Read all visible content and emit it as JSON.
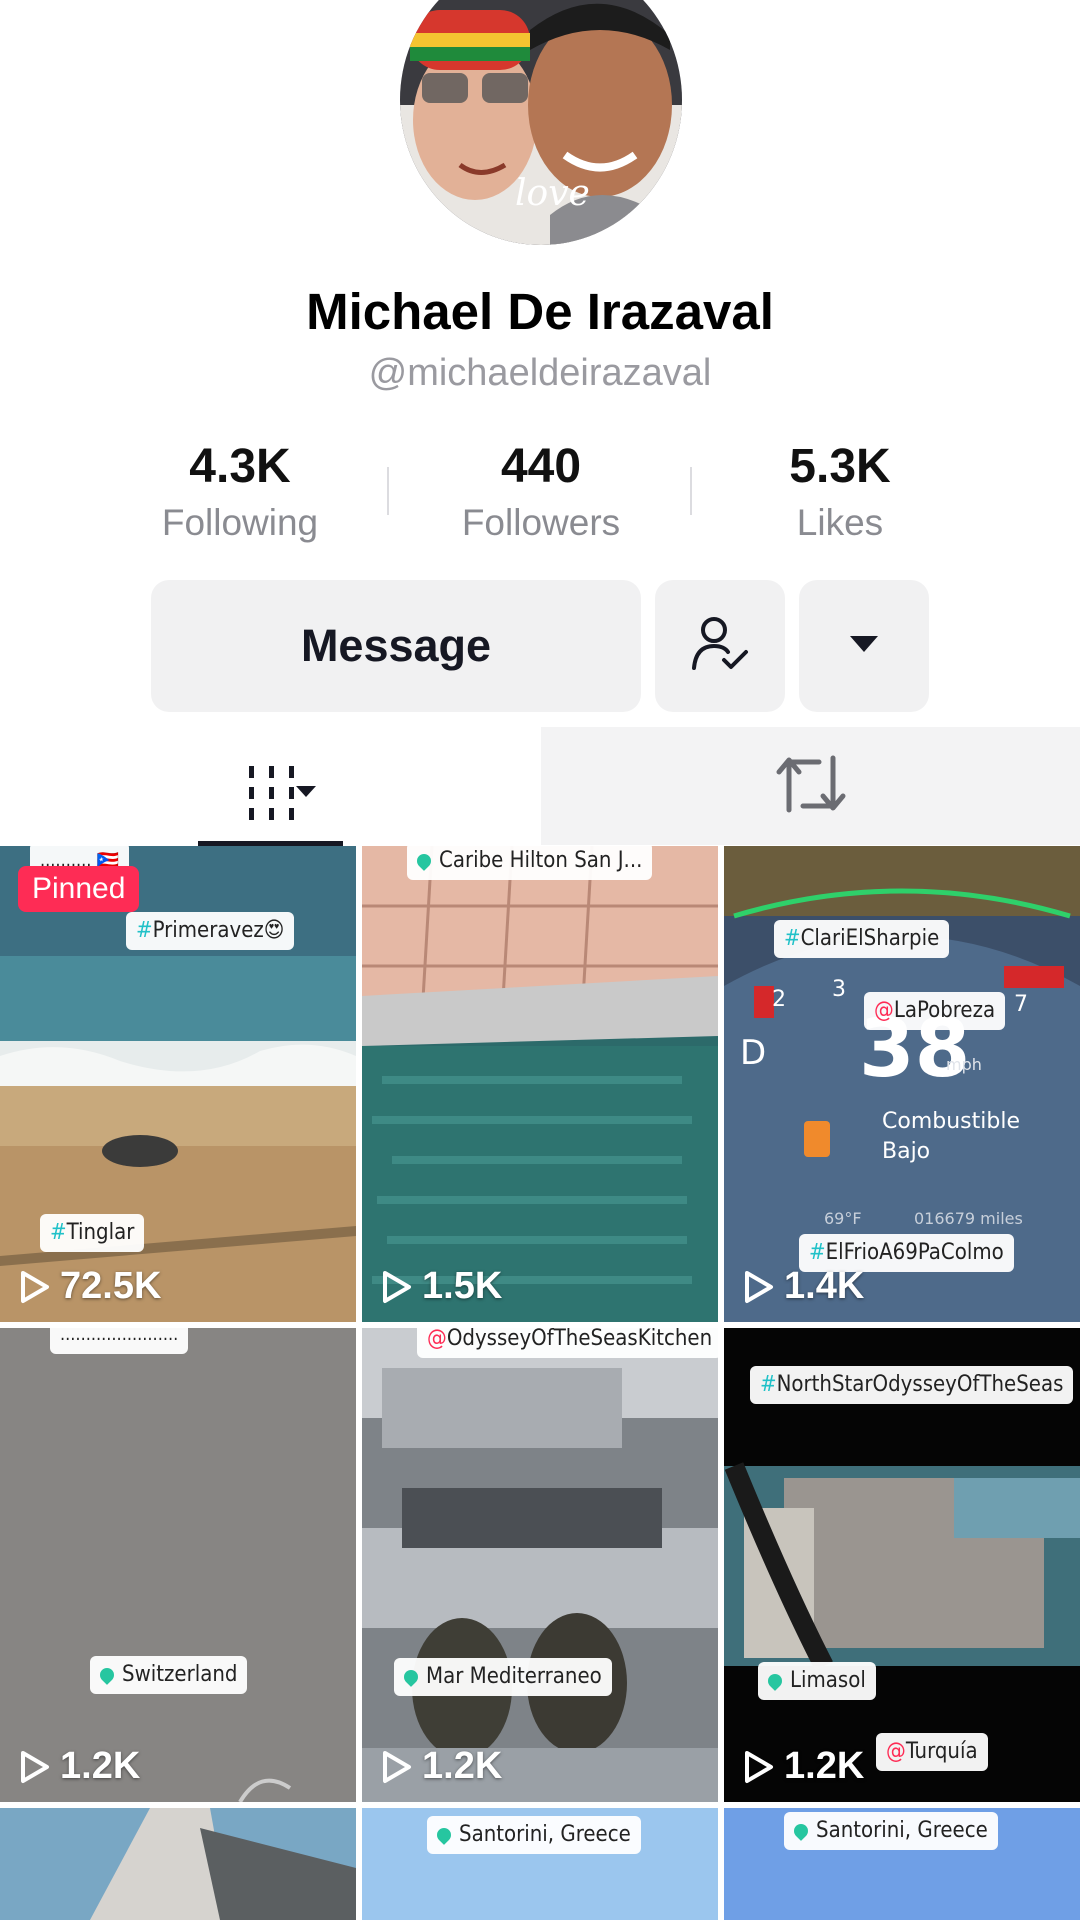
{
  "profile": {
    "name": "Michael De Irazaval",
    "handle": "@michaeldeirazaval",
    "stats": [
      {
        "value": "4.3K",
        "label": "Following"
      },
      {
        "value": "440",
        "label": "Followers"
      },
      {
        "value": "5.3K",
        "label": "Likes"
      }
    ]
  },
  "actions": {
    "message_label": "Message",
    "follow_icon": "person-check-icon",
    "more_icon": "caret-down-icon"
  },
  "tabs": {
    "videos_icon": "grid-bars-icon",
    "repost_icon": "repost-icon"
  },
  "grid": {
    "pinned_label": "Pinned",
    "tiles": [
      {
        "views": "72.5K",
        "tags": [
          "#Primeravez😍",
          "#Tinglar"
        ]
      },
      {
        "views": "1.5K",
        "tags": [
          "Caribe Hilton San J..."
        ]
      },
      {
        "views": "1.4K",
        "tags": [
          "#ClariElSharpie",
          "@LaPobreza",
          "#ElFrioA69PaColmo"
        ],
        "overlay": {
          "gear": "D",
          "unit": "mph",
          "fuel_line1": "Combustible",
          "fuel_line2": "Bajo",
          "temp": "69°F",
          "odometer": "016679 miles"
        }
      },
      {
        "views": "1.2K",
        "tags": [
          "Switzerland"
        ]
      },
      {
        "views": "1.2K",
        "tags": [
          "@OdysseyOfTheSeasKitchen",
          "Mar Mediterraneo"
        ]
      },
      {
        "views": "1.2K",
        "tags": [
          "#NorthStarOdysseyOfTheSeas",
          "Limasol",
          "@Turquía"
        ]
      },
      {
        "views": "",
        "tags": []
      },
      {
        "views": "",
        "tags": [
          "Santorini, Greece"
        ]
      },
      {
        "views": "",
        "tags": [
          "Santorini, Greece"
        ]
      }
    ]
  },
  "colors": {
    "accent": "#fe2c55",
    "hashtag": "#20c1c8",
    "button_bg": "#f1f1f2"
  }
}
